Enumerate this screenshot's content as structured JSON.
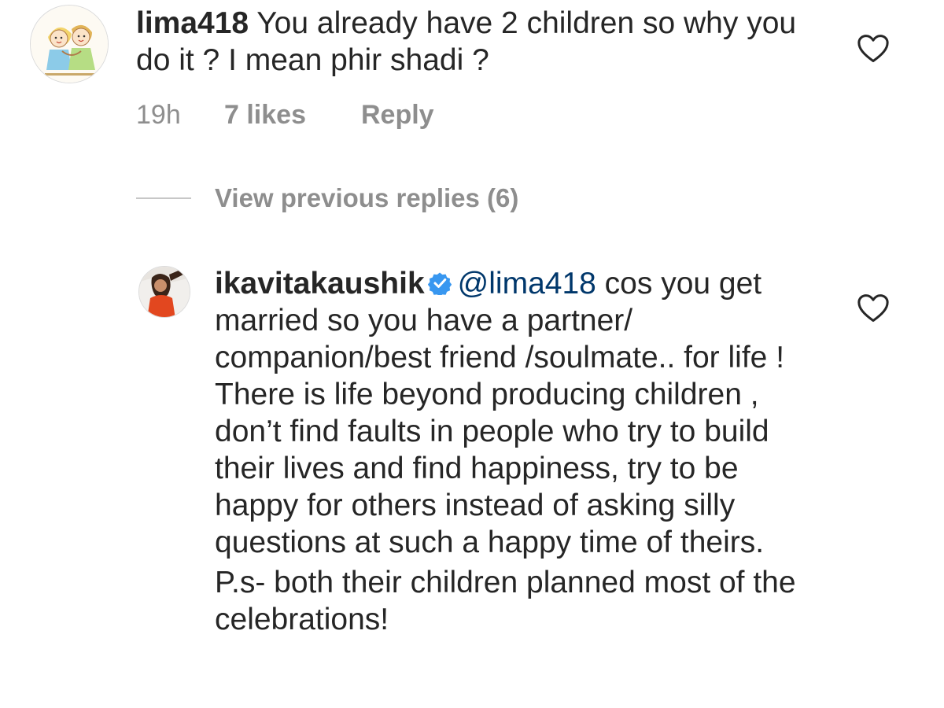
{
  "comments": [
    {
      "username": "lima418",
      "text": "You already have 2 children so why you do it ? I mean phir shadi ?",
      "avatar_icon": "cartoon-hugging-kids-icon",
      "time": "19h",
      "likes": "7 likes",
      "reply_label": "Reply",
      "like_icon": "heart-outline-icon"
    }
  ],
  "replies": {
    "view_previous_label": "View previous replies (6)",
    "items": [
      {
        "username": "ikavitakaushik",
        "verified": true,
        "verified_color": "#3897f0",
        "mention": "@lima418",
        "text": " cos you get married so you have a partner/ companion/best friend /soulmate.. for life ! There is life beyond producing children , don’t find faults in people who try to build their lives and find happiness, try to be happy for others instead of asking silly questions at such a happy time of theirs.",
        "ps": "P.s- both their children planned most of the celebrations!",
        "avatar_icon": "profile-photo-icon",
        "like_icon": "heart-outline-icon"
      }
    ]
  },
  "colors": {
    "text": "#262626",
    "muted": "#8e8e8e",
    "mention": "#00376b",
    "divider": "#c7c7c7"
  }
}
